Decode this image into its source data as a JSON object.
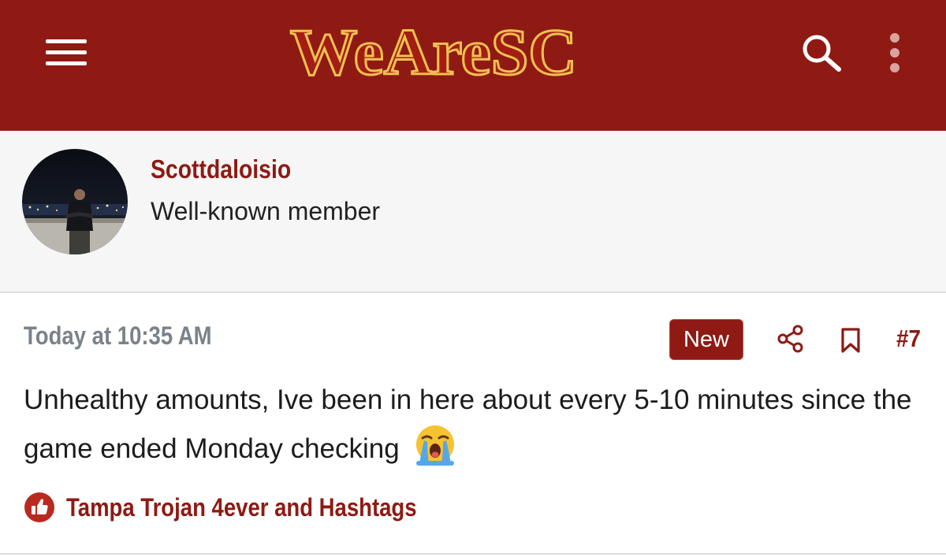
{
  "header": {
    "logo_text": "WeAreSC",
    "menu_icon": "hamburger-menu-icon",
    "search_icon": "search-icon",
    "more_icon": "vertical-ellipsis-icon",
    "colors": {
      "background": "#8e1a13",
      "logo_fill": "#a31d15",
      "logo_outline": "#f2c14e"
    }
  },
  "author": {
    "username": "Scottdaloisio",
    "user_title": "Well-known member",
    "avatar_icon": "user-avatar-photo"
  },
  "post": {
    "date": "Today at 10:35 AM",
    "new_badge": "New",
    "share_icon": "share-icon",
    "bookmark_icon": "bookmark-icon",
    "post_number": "#7",
    "body": "Unhealthy amounts, Ive been in here about every 5-10 minutes since the game ended Monday checking",
    "body_emoji": "loudly-crying-face-emoji",
    "reaction_icon": "thumbs-up-icon",
    "reactions_text": "Tampa Trojan 4ever and Hashtags"
  },
  "colors": {
    "brand": "#8e1a13",
    "muted_text": "#7b8289",
    "panel_background": "#f6f6f6"
  }
}
